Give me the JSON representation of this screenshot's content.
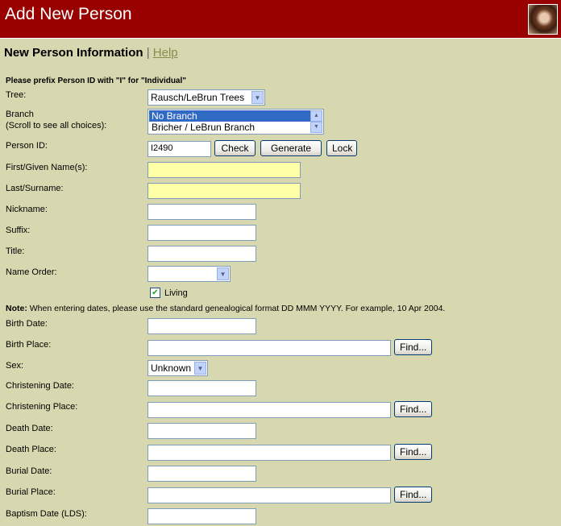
{
  "header": {
    "title": "Add New Person"
  },
  "subheader": {
    "title": "New Person Information",
    "separator": "|",
    "help": "Help"
  },
  "form": {
    "prefix_note": "Please prefix Person ID with \"I\" for \"Individual\"",
    "tree_label": "Tree:",
    "tree_value": "Rausch/LeBrun Trees",
    "branch_label": "Branch",
    "branch_sublabel": "(Scroll to see all choices):",
    "branch_options": [
      "No Branch",
      "Bricher / LeBrun Branch"
    ],
    "personid_label": "Person ID:",
    "personid_value": "I2490",
    "check_button": "Check",
    "generate_button": "Generate",
    "lock_button": "Lock",
    "firstname_label": "First/Given Name(s):",
    "lastname_label": "Last/Surname:",
    "nickname_label": "Nickname:",
    "suffix_label": "Suffix:",
    "title_label": "Title:",
    "nameorder_label": "Name Order:",
    "nameorder_value": "",
    "living_label": "Living",
    "living_checked": true,
    "date_note_bold": "Note:",
    "date_note": " When entering dates, please use the standard genealogical format DD MMM YYYY. For example, 10 Apr 2004.",
    "birthdate_label": "Birth Date:",
    "birthplace_label": "Birth Place:",
    "find_button": "Find...",
    "sex_label": "Sex:",
    "sex_value": "Unknown",
    "christdate_label": "Christening Date:",
    "christplace_label": "Christening Place:",
    "deathdate_label": "Death Date:",
    "deathplace_label": "Death Place:",
    "burialdate_label": "Burial Date:",
    "burialplace_label": "Burial Place:",
    "baptismdate_label": "Baptism Date (LDS):"
  },
  "colors": {
    "header_bg": "#990000",
    "page_bg": "#d8d8b0",
    "required_field_bg": "#ffffa8",
    "selection": "#316ac5"
  }
}
